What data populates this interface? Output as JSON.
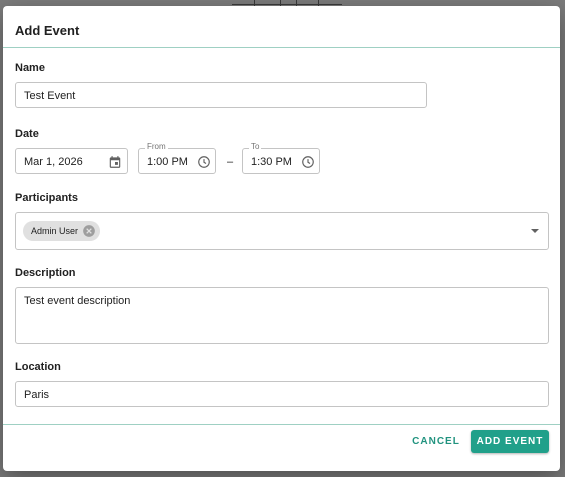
{
  "dialog": {
    "title": "Add Event",
    "name": {
      "label": "Name",
      "value": "Test Event"
    },
    "date": {
      "label": "Date",
      "value": "Mar 1, 2026",
      "from_caption": "From",
      "from_value": "1:00 PM",
      "separator": "–",
      "to_caption": "To",
      "to_value": "1:30 PM"
    },
    "participants": {
      "label": "Participants",
      "chips": [
        "Admin User"
      ]
    },
    "description": {
      "label": "Description",
      "value": "Test event description"
    },
    "location": {
      "label": "Location",
      "value": "Paris"
    },
    "actions": {
      "cancel_label": "CANCEL",
      "submit_label": "ADD EVENT"
    }
  },
  "colors": {
    "accent": "#21a08a",
    "accent_text": "#21937f",
    "divider": "#9fd0c3",
    "overlay": "#7b7b7b"
  },
  "icons": [
    "calendar-icon",
    "clock-icon",
    "chip-remove-icon",
    "dropdown-arrow-icon"
  ]
}
